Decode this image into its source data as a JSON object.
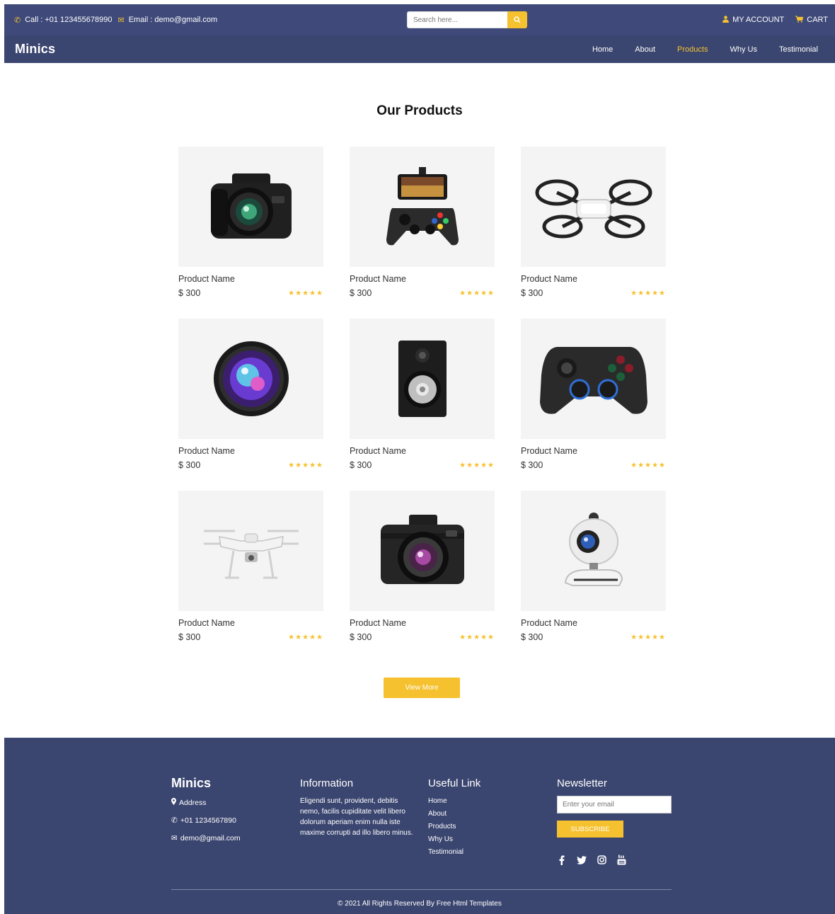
{
  "topbar": {
    "call": "Call : +01 123455678990",
    "email": "Email : demo@gmail.com",
    "search_placeholder": "Search here...",
    "my_account": "MY ACCOUNT",
    "cart": "CART"
  },
  "navbar": {
    "brand": "Minics",
    "links": [
      "Home",
      "About",
      "Products",
      "Why Us",
      "Testimonial"
    ],
    "active": "Products"
  },
  "products": {
    "title": "Our Products",
    "items": [
      {
        "name": "Product Name",
        "price": "$ 300",
        "stars": "★★★★★",
        "icon": "dslr-camera-icon"
      },
      {
        "name": "Product Name",
        "price": "$ 300",
        "stars": "★★★★★",
        "icon": "phone-gamepad-icon"
      },
      {
        "name": "Product Name",
        "price": "$ 300",
        "stars": "★★★★★",
        "icon": "mini-drone-icon"
      },
      {
        "name": "Product Name",
        "price": "$ 300",
        "stars": "★★★★★",
        "icon": "camera-lens-icon"
      },
      {
        "name": "Product Name",
        "price": "$ 300",
        "stars": "★★★★★",
        "icon": "speaker-icon"
      },
      {
        "name": "Product Name",
        "price": "$ 300",
        "stars": "★★★★★",
        "icon": "gamepad-icon"
      },
      {
        "name": "Product Name",
        "price": "$ 300",
        "stars": "★★★★★",
        "icon": "drone-icon"
      },
      {
        "name": "Product Name",
        "price": "$ 300",
        "stars": "★★★★★",
        "icon": "compact-camera-icon"
      },
      {
        "name": "Product Name",
        "price": "$ 300",
        "stars": "★★★★★",
        "icon": "webcam-icon"
      }
    ],
    "view_more": "View More"
  },
  "footer": {
    "brand": "Minics",
    "address": "Address",
    "phone": "+01 1234567890",
    "email": "demo@gmail.com",
    "info_title": "Information",
    "info_text": "Eligendi sunt, provident, debitis nemo, facilis cupiditate velit libero dolorum aperiam enim nulla iste maxime corrupti ad illo libero minus.",
    "links_title": "Useful Link",
    "links": [
      "Home",
      "About",
      "Products",
      "Why Us",
      "Testimonial"
    ],
    "newsletter_title": "Newsletter",
    "newsletter_placeholder": "Enter your email",
    "subscribe": "SUBSCRIBE",
    "social": [
      "facebook-icon",
      "twitter-icon",
      "instagram-icon",
      "youtube-icon"
    ],
    "copyright": "© 2021 All Rights Reserved By Free Html Templates"
  },
  "colors": {
    "primary": "#3b4670",
    "accent": "#f5c12e"
  }
}
